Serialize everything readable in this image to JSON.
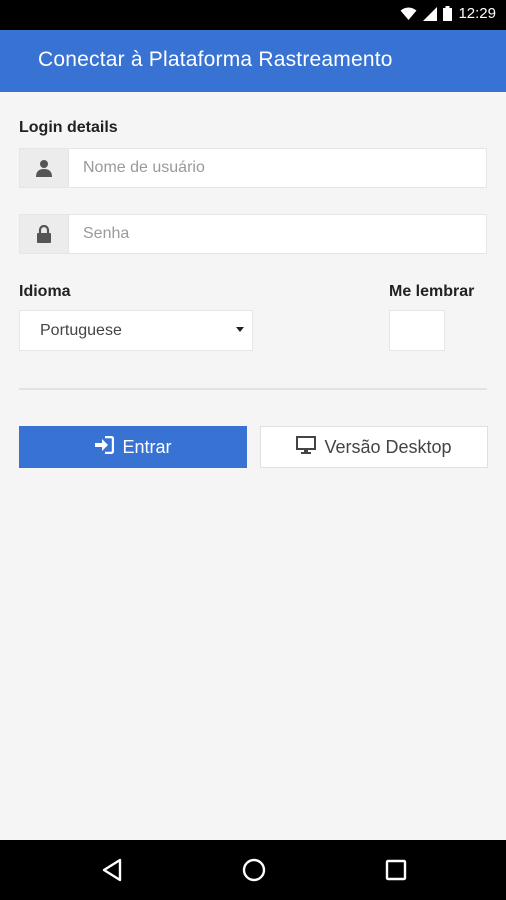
{
  "status_bar": {
    "time": "12:29",
    "icons": [
      "wifi-icon",
      "signal-icon",
      "battery-icon"
    ]
  },
  "header": {
    "title": "Conectar à Plataforma Rastreamento"
  },
  "form": {
    "section_label": "Login details",
    "username": {
      "value": "",
      "placeholder": "Nome de usuário",
      "icon": "user-icon"
    },
    "password": {
      "value": "",
      "placeholder": "Senha",
      "icon": "lock-icon"
    },
    "language_label": "Idioma",
    "language_selected": "Portuguese",
    "remember_label": "Me lembrar",
    "remember_checked": false
  },
  "buttons": {
    "login_label": "Entrar",
    "login_icon": "sign-in-icon",
    "desktop_label": "Versão Desktop",
    "desktop_icon": "desktop-icon"
  },
  "nav": {
    "icons": [
      "back-icon",
      "home-icon",
      "recents-icon"
    ]
  },
  "colors": {
    "primary": "#3872d2",
    "background": "#f5f5f5",
    "system_bar": "#000000"
  }
}
